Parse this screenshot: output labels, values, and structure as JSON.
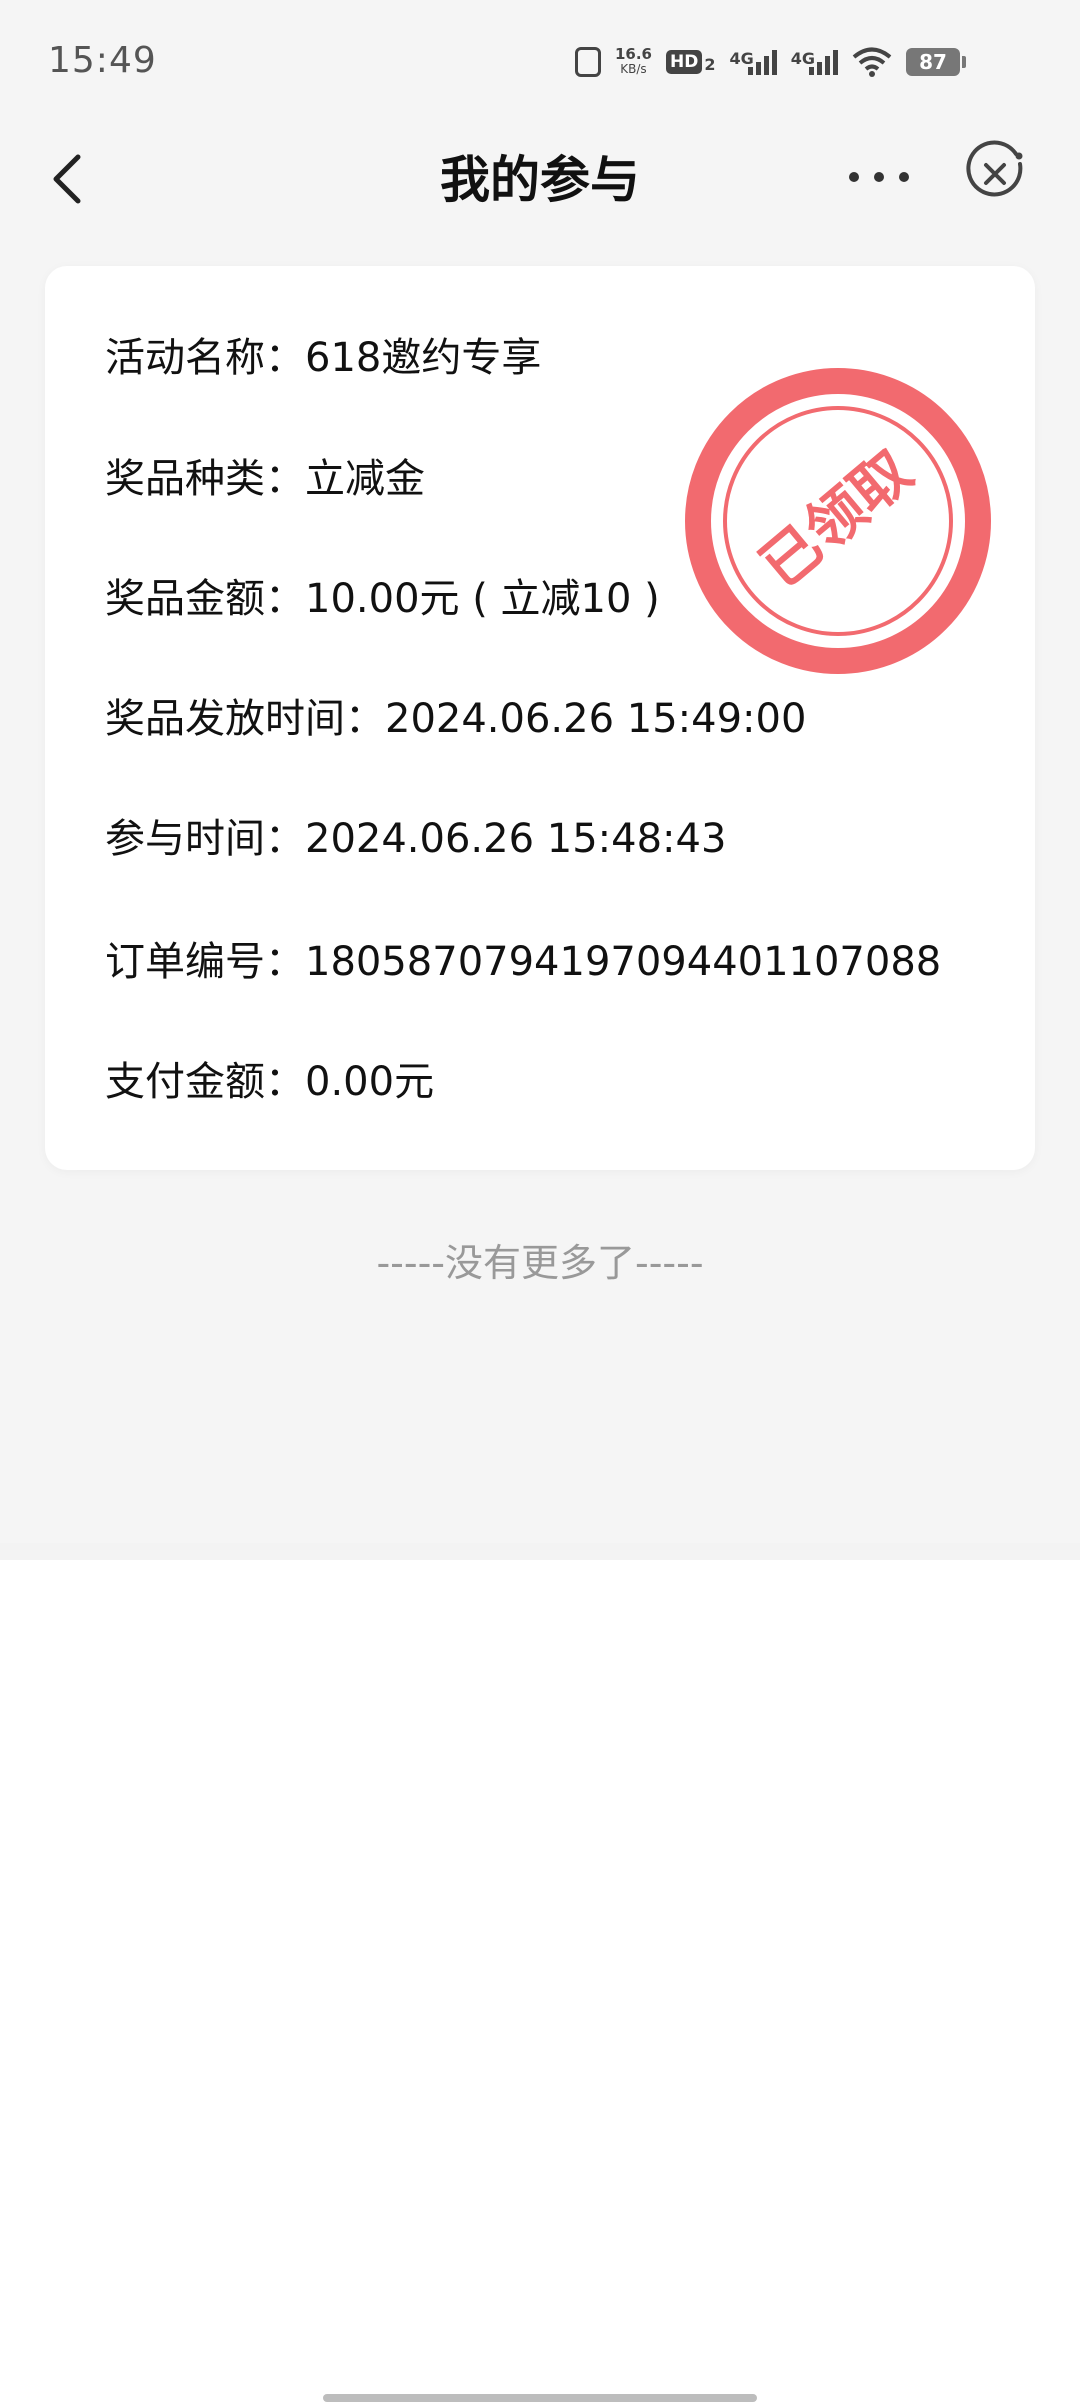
{
  "status_bar": {
    "time": "15:49",
    "speed_value": "16.6",
    "speed_unit": "KB/s",
    "hd_label": "HD",
    "hd_sub": "2",
    "net1": "4G",
    "net2": "4G",
    "battery": "87"
  },
  "nav": {
    "title": "我的参与"
  },
  "record": {
    "fields": [
      {
        "label": "活动名称：",
        "value": "618邀约专享"
      },
      {
        "label": "奖品种类：",
        "value": "立减金"
      },
      {
        "label": "奖品金额：",
        "value": "10.00元 ( 立减10 )"
      },
      {
        "label": "奖品发放时间：",
        "value": "2024.06.26 15:49:00"
      },
      {
        "label": "参与时间：",
        "value": "2024.06.26 15:48:43"
      },
      {
        "label": "订单编号：",
        "value": "1805870794197094401107088"
      },
      {
        "label": "支付金额：",
        "value": "0.00元"
      }
    ],
    "stamp_text": "已领取",
    "stamp_color": "#f05a60"
  },
  "footer_text": "-----没有更多了-----"
}
